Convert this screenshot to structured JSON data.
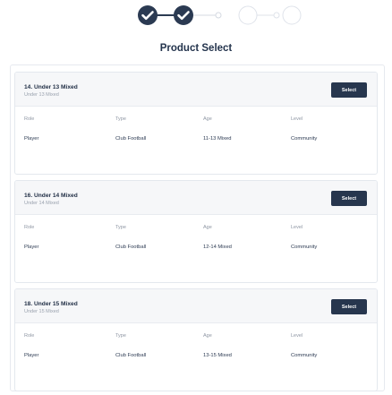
{
  "page": {
    "title": "Product Select"
  },
  "stepper": {
    "total_steps": 5,
    "completed_steps": 2,
    "active_color": "#2b3a52",
    "inactive_color": "#d4d9e1",
    "check_icon": "check-icon"
  },
  "columns": {
    "role": "Role",
    "type": "Type",
    "age": "Age",
    "level": "Level"
  },
  "products": [
    {
      "name": "14. Under 13 Mixed",
      "subtitle": "Under 13 Mixed",
      "select_label": "Select",
      "role": "Player",
      "type": "Club Football",
      "age": "11-13 Mixed",
      "level": "Community"
    },
    {
      "name": "16. Under 14 Mixed",
      "subtitle": "Under 14 Mixed",
      "select_label": "Select",
      "role": "Player",
      "type": "Club Football",
      "age": "12-14 Mixed",
      "level": "Community"
    },
    {
      "name": "18. Under 15 Mixed",
      "subtitle": "Under 15 Mixed",
      "select_label": "Select",
      "role": "Player",
      "type": "Club Football",
      "age": "13-15 Mixed",
      "level": "Community"
    }
  ]
}
